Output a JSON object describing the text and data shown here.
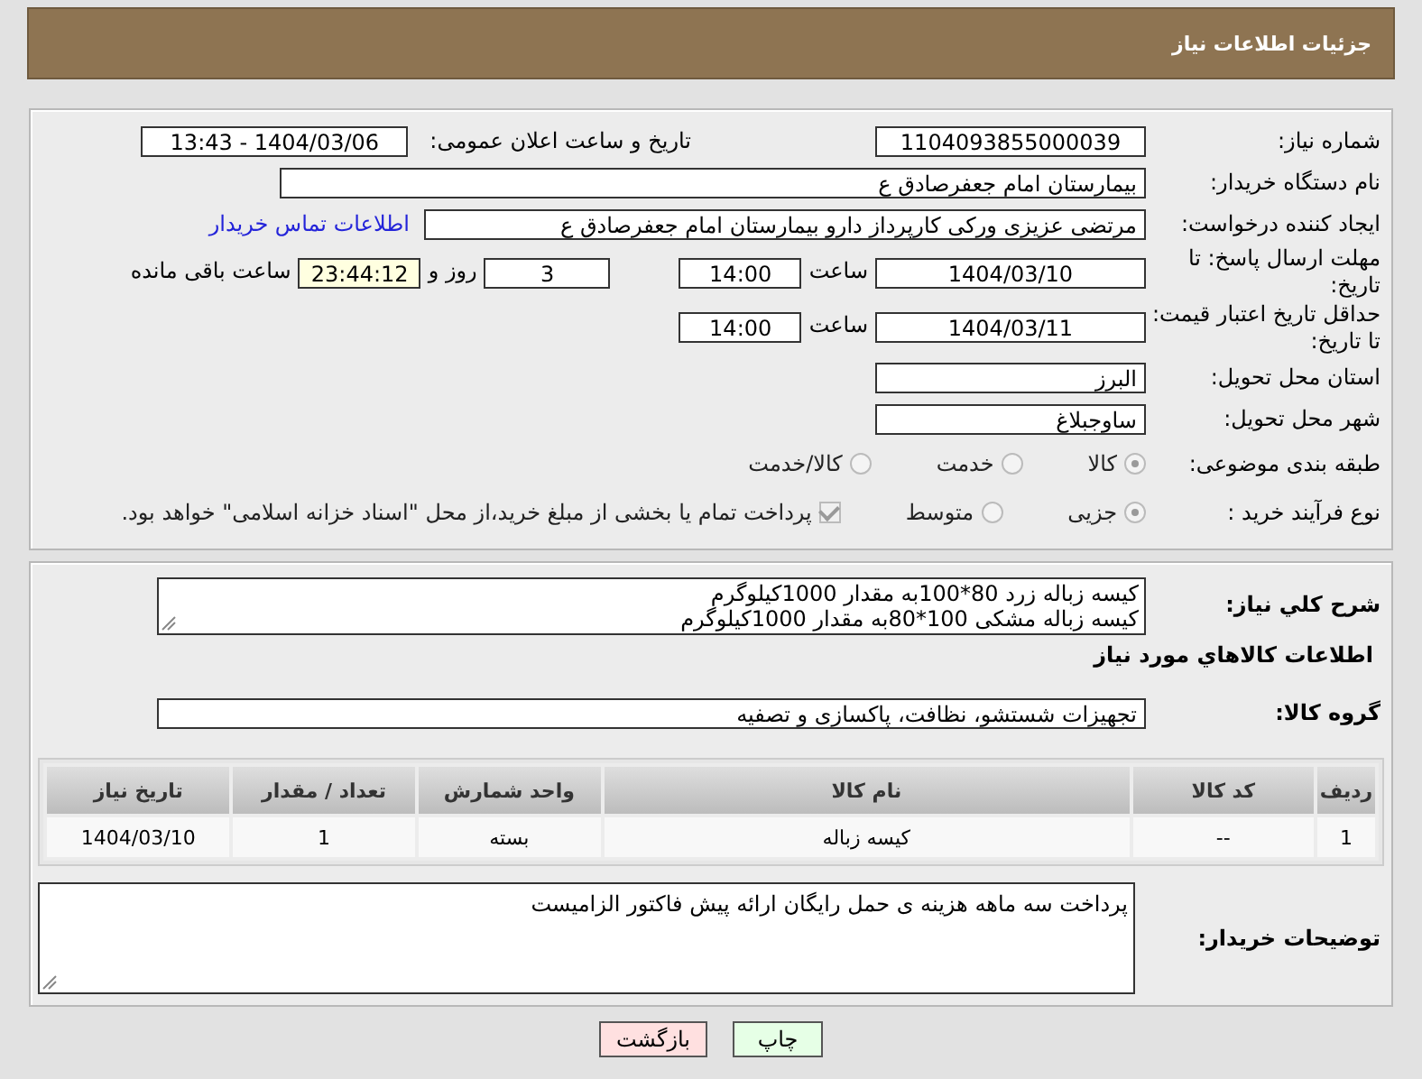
{
  "header": {
    "title": "جزئیات اطلاعات نیاز"
  },
  "need_number": {
    "label": "شماره نیاز:",
    "value": "1104093855000039"
  },
  "announce": {
    "label": "تاریخ و ساعت اعلان عمومی:",
    "value": "1404/03/06 - 13:43"
  },
  "buyer_org": {
    "label": "نام دستگاه خریدار:",
    "value": "بیمارستان امام جعفرصادق ع"
  },
  "requester": {
    "label": "ایجاد کننده درخواست:",
    "value": "مرتضی عزیزی ورکی کارپرداز دارو بیمارستان امام جعفرصادق ع",
    "link": "اطلاعات تماس خریدار"
  },
  "reply_deadline": {
    "label": "مهلت ارسال پاسخ: تا تاریخ:",
    "date": "1404/03/10",
    "time_label": "ساعت",
    "time": "14:00",
    "days": "3",
    "days_label": "روز و",
    "remaining": "23:44:12",
    "remaining_label": "ساعت باقی مانده"
  },
  "price_validity": {
    "label": "حداقل تاریخ اعتبار قیمت: تا تاریخ:",
    "date": "1404/03/11",
    "time_label": "ساعت",
    "time": "14:00"
  },
  "province": {
    "label": "استان محل تحویل:",
    "value": "البرز"
  },
  "city": {
    "label": "شهر محل تحویل:",
    "value": "ساوجبلاغ"
  },
  "category": {
    "label": "طبقه بندی موضوعی:",
    "options": [
      {
        "label": "کالا",
        "selected": true
      },
      {
        "label": "خدمت",
        "selected": false
      },
      {
        "label": "کالا/خدمت",
        "selected": false
      }
    ]
  },
  "process": {
    "label": "نوع فرآیند خرید :",
    "options": [
      {
        "label": "جزیی",
        "selected": true
      },
      {
        "label": "متوسط",
        "selected": false
      }
    ],
    "payment_note": {
      "label": "پرداخت تمام یا بخشی از مبلغ خرید،از محل \"اسناد خزانه اسلامی\" خواهد بود.",
      "checked": true
    }
  },
  "description": {
    "label": "شرح کلي نیاز:",
    "lines": [
      "کیسه زباله زرد 80*100به مقدار 1000کیلوگرم",
      "کیسه زباله مشکی 100*80به مقدار 1000کیلوگرم"
    ]
  },
  "goods_title": "اطلاعات کالاهاي مورد نیاز",
  "goods_group": {
    "label": "گروه کالا:",
    "value": "تجهیزات شستشو، نظافت، پاکسازی و تصفیه"
  },
  "table": {
    "columns": [
      "ردیف",
      "کد کالا",
      "نام کالا",
      "واحد شمارش",
      "تعداد / مقدار",
      "تاریخ نیاز"
    ],
    "rows": [
      [
        "1",
        "--",
        "کیسه زباله",
        "بسته",
        "1",
        "1404/03/10"
      ]
    ]
  },
  "buyer_notes": {
    "label": "توضیحات خریدار:",
    "value": "پرداخت سه ماهه هزینه ی حمل رایگان ارائه پیش فاکتور الزامیست"
  },
  "buttons": [
    {
      "label": "چاپ",
      "kind": "print"
    },
    {
      "label": "بازگشت",
      "kind": "back"
    }
  ]
}
